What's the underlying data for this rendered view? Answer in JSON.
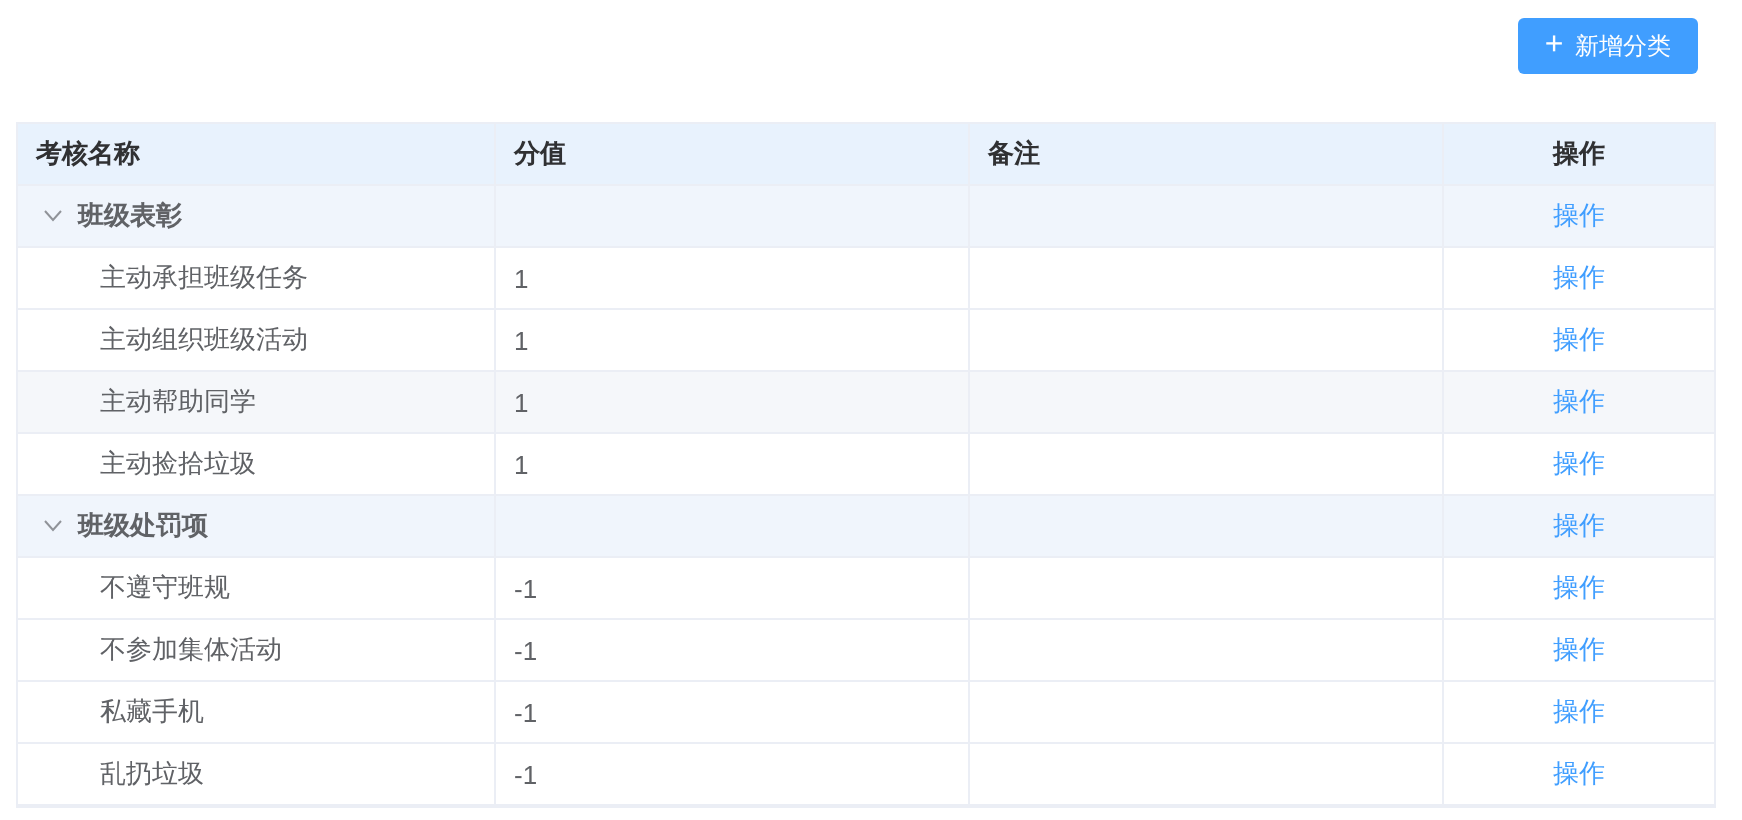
{
  "toolbar": {
    "add_button": {
      "icon": "+",
      "label": "新增分类"
    }
  },
  "table": {
    "columns": [
      "考核名称",
      "分值",
      "备注",
      "操作"
    ],
    "groups": [
      {
        "name": "班级表彰",
        "expanded": true,
        "action": "操作",
        "children": [
          {
            "name": "主动承担班级任务",
            "score": "1",
            "action": "操作",
            "hovered": false
          },
          {
            "name": "主动组织班级活动",
            "score": "1",
            "action": "操作",
            "hovered": false
          },
          {
            "name": "主动帮助同学",
            "score": "1",
            "action": "操作",
            "hovered": true
          },
          {
            "name": "主动捡拾垃圾",
            "score": "1",
            "action": "操作",
            "hovered": false
          }
        ]
      },
      {
        "name": "班级处罚项",
        "expanded": true,
        "action": "操作",
        "children": [
          {
            "name": "不遵守班规",
            "score": "-1",
            "action": "操作",
            "hovered": false
          },
          {
            "name": "不参加集体活动",
            "score": "-1",
            "action": "操作",
            "hovered": false
          },
          {
            "name": "私藏手机",
            "score": "-1",
            "action": "操作",
            "hovered": false
          },
          {
            "name": "乱扔垃圾",
            "score": "-1",
            "action": "操作",
            "hovered": false
          }
        ]
      }
    ]
  }
}
